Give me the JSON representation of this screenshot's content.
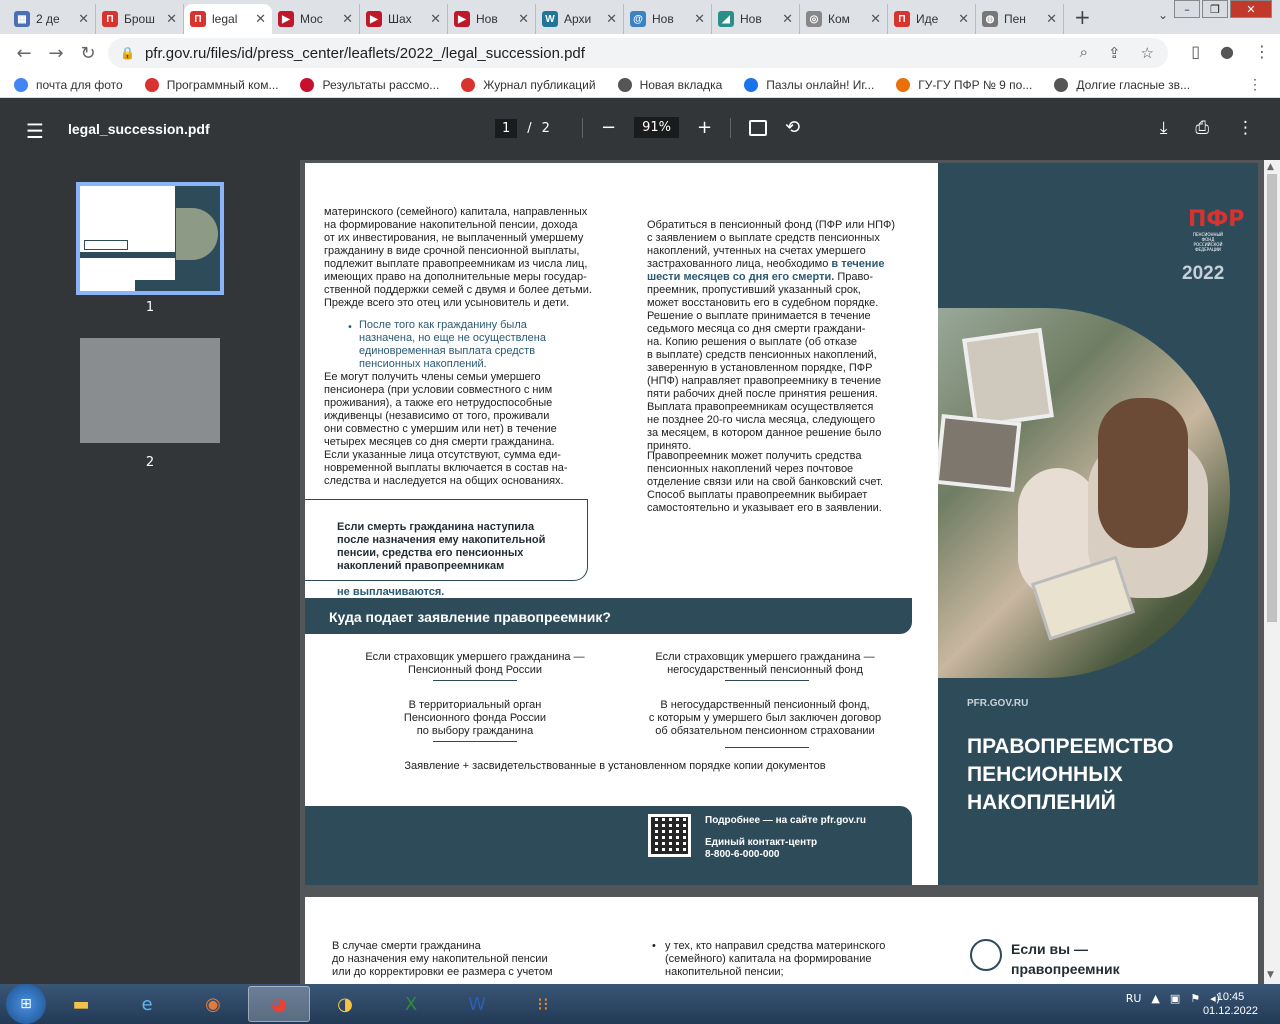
{
  "tabs": [
    {
      "title": "2 де",
      "color": "#4a6fb5",
      "glyph": "▦"
    },
    {
      "title": "Брош",
      "color": "#d9332f",
      "glyph": "П"
    },
    {
      "title": "legal",
      "color": "#d9332f",
      "glyph": "П",
      "active": true
    },
    {
      "title": "Мос",
      "color": "#c0172b",
      "glyph": "▶"
    },
    {
      "title": "Шах",
      "color": "#c0172b",
      "glyph": "▶"
    },
    {
      "title": "Нов",
      "color": "#c0172b",
      "glyph": "▶"
    },
    {
      "title": "Архи",
      "color": "#21759b",
      "glyph": "W"
    },
    {
      "title": "Нов",
      "color": "#3b82c4",
      "glyph": "@"
    },
    {
      "title": "Нов",
      "color": "#2a8f8a",
      "glyph": "◢"
    },
    {
      "title": "Ком",
      "color": "#888",
      "glyph": "◎"
    },
    {
      "title": "Иде",
      "color": "#d9332f",
      "glyph": "П"
    },
    {
      "title": "Пен",
      "color": "#777",
      "glyph": "◍"
    }
  ],
  "address": {
    "url": "pfr.gov.ru/files/id/press_center/leaflets/2022_/legal_succession.pdf"
  },
  "bookmarks": [
    {
      "label": "почта для фото",
      "color": "#4285f4"
    },
    {
      "label": "Программный ком...",
      "color": "#d9332f"
    },
    {
      "label": "Результаты рассмо...",
      "color": "#c8102e"
    },
    {
      "label": "Журнал публикаций",
      "color": "#d9332f"
    },
    {
      "label": "Новая вкладка",
      "color": "#555"
    },
    {
      "label": "Пазлы онлайн! Иг...",
      "color": "#1a73e8"
    },
    {
      "label": "ГУ-ГУ ПФР № 9 по...",
      "color": "#e8710a"
    },
    {
      "label": "Долгие гласные зв...",
      "color": "#555"
    }
  ],
  "viewer": {
    "filename": "legal_succession.pdf",
    "page": "1",
    "total": "2",
    "zoom": "91%"
  },
  "thumbs": {
    "p1": "1",
    "p2": "2"
  },
  "page1": {
    "col1": "материнского (семейного) капитала, направленных\nна формирование накопительной пенсии, дохода\nот их инвестирования, не выплаченный умершему\nгражданину в виде срочной пенсионной выплаты,\nподлежит выплате правопреемникам из числа лиц,\nимеющих право на дополнительные меры государ-\nственной поддержки семей с двумя и более детьми.\nПрежде всего это отец или усыновитель и дети.",
    "bullet": "После того как гражданину была\nназначена, но еще не осуществлена\nединовременная выплата средств\nпенсионных накоплений.",
    "col1b": "Ее могут получить члены семьи умершего\nпенсионера (при условии совместного с ним\nпроживания), а также его нетрудоспособные\nиждивенцы (независимо от того, проживали\nони совместно с умершим или нет) в течение\nчетырех месяцев со дня смерти гражданина.\nЕсли указанные лица отсутствуют, сумма еди-\nновременной выплаты включается в состав на-\nследства и наследуется на общих основаниях.",
    "callout": "Если смерть гражданина наступила\nпосле назначения ему накопительной\nпенсии, средства его пенсионных\nнакоплений правопреемникам",
    "callout_hl": "не выплачиваются.",
    "col2a": "Обратиться в пенсионный фонд (ПФР или НПФ)\nс заявлением о выплате средств пенсионных\nнакоплений, учтенных на счетах умершего\nзастрахованного лица, необходимо",
    "col2_hl": "в течение\nшести месяцев со дня его смерти.",
    "col2b": "Право-\nпреемник, пропустивший указанный срок,\nможет восстановить его в судебном порядке.\nРешение о выплате принимается в течение\nседьмого месяца со дня смерти граждани-\nна. Копию решения о выплате (об отказе\nв выплате) средств пенсионных накоплений,\nзаверенную в установленном порядке, ПФР\n(НПФ) направляет правопреемнику в течение\nпяти рабочих дней после принятия решения.\nВыплата правопреемникам осуществляется\nне позднее 20-го числа месяца, следующего\nза месяцем, в котором данное решение было\nпринято.",
    "col2c": "Правопреемник может получить средства\nпенсионных накоплений через почтовое\nотделение связи или на свой банковский счет.\nСпособ выплаты правопреемник выбирает\nсамостоятельно и указывает его в заявлении.",
    "banner": "Куда подает заявление правопреемник?",
    "f1": "Если страховщик умершего гражданина —\nПенсионный фонд России",
    "f2": "Если страховщик умершего гражданина —\nнегосударственный пенсионный фонд",
    "f3": "В территориальный орган\nПенсионного фонда России\nпо выбору гражданина",
    "f4": "В негосударственный пенсионный фонд,\nс которым у умершего был заключен договор\nоб обязательном пенсионном страховании",
    "f5": "Заявление + засвидетельствованные в установленном порядке копии документов",
    "ft1": "Подробнее — на сайте pfr.gov.ru",
    "ft2": "Единый контакт-центр\n8-800-6-000-000",
    "logo_text": "ПЕНСИОННЫЙ ФОНД\nРОССИЙСКОЙ ФЕДЕРАЦИИ",
    "year": "2022",
    "site": "PFR.GOV.RU",
    "title": "ПРАВОПРЕЕМСТВО\nПЕНСИОННЫХ\nНАКОПЛЕНИЙ"
  },
  "page2": {
    "c1": "В случае смерти гражданина\nдо назначения ему накопительной пенсии\nили до корректировки ее размера с учетом",
    "c2": "у тех, кто направил средства материнского\n(семейного) капитала на формирование\nнакопительной пенсии;",
    "c3": "Если вы —\nправопреемник"
  },
  "taskbar": {
    "lang": "RU",
    "time": "10:45",
    "date": "01.12.2022"
  }
}
